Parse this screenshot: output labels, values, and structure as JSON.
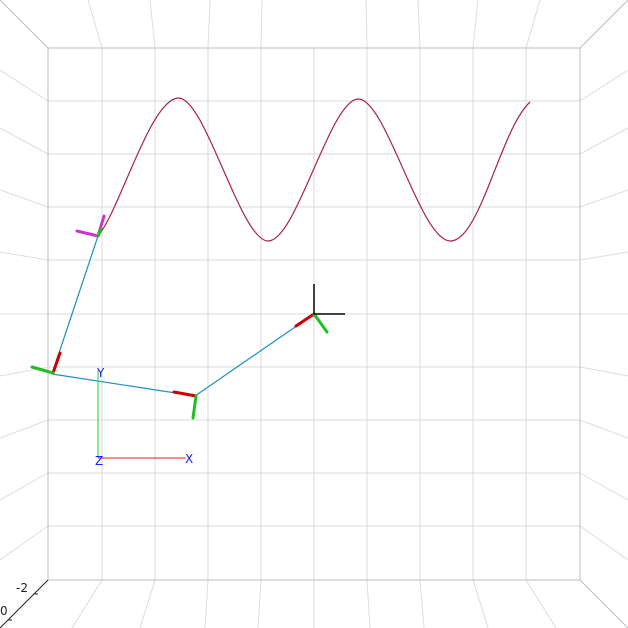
{
  "scene": {
    "background": "#ffffff",
    "grid_color": "#d9d9d9",
    "edge_color": "#bdbdbd",
    "curve_color": "#a8234f",
    "link_color": "#1f8fc6"
  },
  "axis_gizmo": {
    "x_label": "X",
    "y_label": "Y",
    "z_label": "Z",
    "x_color": "#e02020",
    "y_color": "#22cc22",
    "label_color": "#1a1aff"
  },
  "corner_ticks": {
    "upper": "-2",
    "lower": "0"
  },
  "frame_colors": {
    "x": "#cc0000",
    "y": "#1fbf1f",
    "z": "#cc33cc",
    "target": "#000000"
  }
}
